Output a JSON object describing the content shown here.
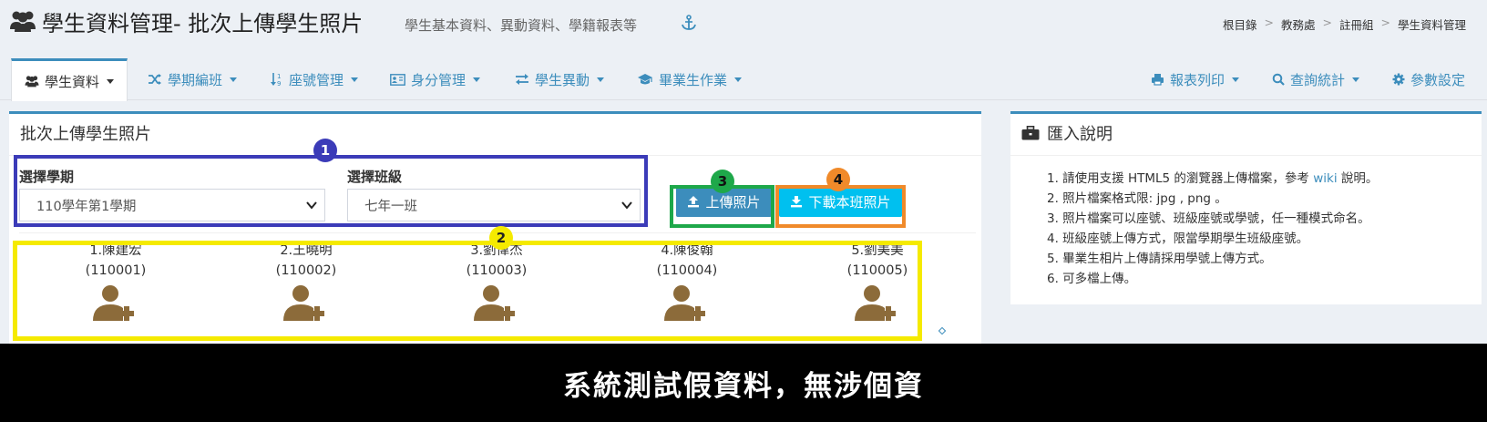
{
  "header": {
    "title": "學生資料管理- 批次上傳學生照片",
    "subtitle": "學生基本資料、異動資料、學籍報表等",
    "breadcrumb": [
      "根目錄",
      "教務處",
      "註冊組",
      "學生資料管理"
    ]
  },
  "nav": {
    "left": [
      {
        "label": "學生資料",
        "icon": "users-icon"
      },
      {
        "label": "學期編班",
        "icon": "shuffle-icon"
      },
      {
        "label": "座號管理",
        "icon": "sort-icon"
      },
      {
        "label": "身分管理",
        "icon": "id-card-icon"
      },
      {
        "label": "學生異動",
        "icon": "exchange-icon"
      },
      {
        "label": "畢業生作業",
        "icon": "graduation-cap-icon"
      }
    ],
    "right": [
      {
        "label": "報表列印",
        "icon": "print-icon"
      },
      {
        "label": "查詢統計",
        "icon": "search-icon"
      },
      {
        "label": "參數設定",
        "icon": "gear-icon"
      }
    ]
  },
  "main": {
    "box_title": "批次上傳學生照片",
    "semester_label": "選擇學期",
    "semester_value": "110學年第1學期",
    "class_label": "選擇班級",
    "class_value": "七年一班",
    "upload_button": "上傳照片",
    "download_button": "下載本班照片",
    "students": [
      {
        "name": "1.陳建宏",
        "id": "(110001)"
      },
      {
        "name": "2.王曉明",
        "id": "(110002)"
      },
      {
        "name": "3.劉偉杰",
        "id": "(110003)"
      },
      {
        "name": "4.陳俊翰",
        "id": "(110004)"
      },
      {
        "name": "5.劉美美",
        "id": "(110005)"
      }
    ]
  },
  "annotations": [
    {
      "number": "1",
      "color": "#3b3bb8"
    },
    {
      "number": "2",
      "color": "#f5ea00"
    },
    {
      "number": "3",
      "color": "#1ea84a"
    },
    {
      "number": "4",
      "color": "#f08a2a"
    }
  ],
  "side": {
    "title": "匯入說明",
    "items": [
      {
        "pre": "1. 請使用支援 HTML5 的瀏覽器上傳檔案，參考 ",
        "link": "wiki",
        "post": " 說明。"
      },
      {
        "pre": "2. 照片檔案格式限: jpg , png 。"
      },
      {
        "pre": "3. 照片檔案可以座號、班級座號或學號，任一種模式命名。"
      },
      {
        "pre": "4. 班級座號上傳方式，限當學期學生班級座號。"
      },
      {
        "pre": "5. 畢業生相片上傳請採用學號上傳方式。"
      },
      {
        "pre": "6. 可多檔上傳。"
      }
    ]
  },
  "caption": "系統測試假資料，無涉個資",
  "colors": {
    "primary": "#3c8dbc",
    "info": "#00c0ef",
    "avatar": "#8c6b3a",
    "caption_bg": "#000000"
  }
}
